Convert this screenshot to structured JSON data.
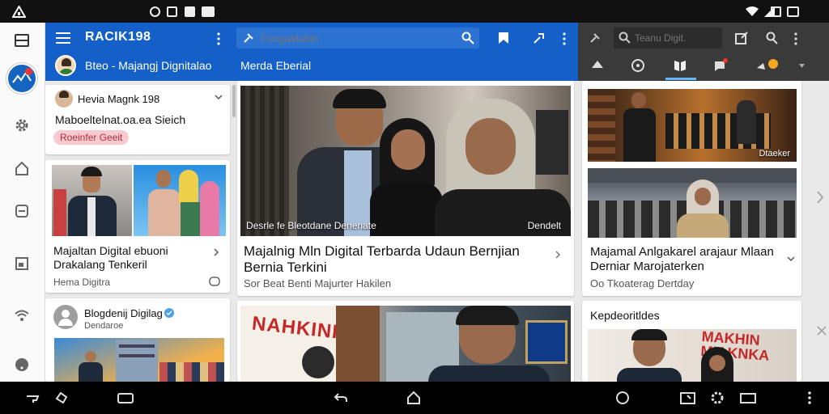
{
  "app": {
    "name": "RACIK198"
  },
  "header": {
    "account_name": "Bteo - Majangj Dignitalao",
    "tab_title": "Merda Eberial",
    "search_placeholder": "Fongaldaldo"
  },
  "right_header": {
    "search_placeholder": "Teanu Digit."
  },
  "left_column": {
    "profile_card": {
      "name": "Hevia  Magnk 198",
      "title": "Maboeltelnat.oa.ea Sieich",
      "tag": "Roeinfer Geeit"
    },
    "story_card": {
      "title": "Majaltan Digital ebuoni Drakalang Tenkeril",
      "source": "Hema Digitra"
    },
    "channel_card": {
      "name": "Blogdenij Digilag",
      "subtitle": "Dendaroe"
    }
  },
  "center_column": {
    "main_story": {
      "image_caption_left": "Desrle fe Bleotdane Denenate",
      "image_caption_right": "Dendelt",
      "title": "Majalnig  Mln Digital Terbarda Udaun Bernjian Bernia Terkini",
      "subtitle": "Sor Beat Benti Majurter Hakilen"
    },
    "second_story": {
      "banner_text": "NAHKINI"
    }
  },
  "right_column": {
    "story": {
      "image_caption": "Dtaeker",
      "title": "Majamal Anlgakarel arajaur Mlaan Derniar Marojaterken",
      "subtitle": "Oo Tkoaterag Dertday"
    },
    "section": {
      "title": "Kepdeoritldes",
      "banner_text": "MAKHIN MIAKNKA"
    }
  },
  "colors": {
    "primary": "#1560c8",
    "dark_header": "#3a3a3a",
    "tag_bg": "#f8c9cf"
  }
}
